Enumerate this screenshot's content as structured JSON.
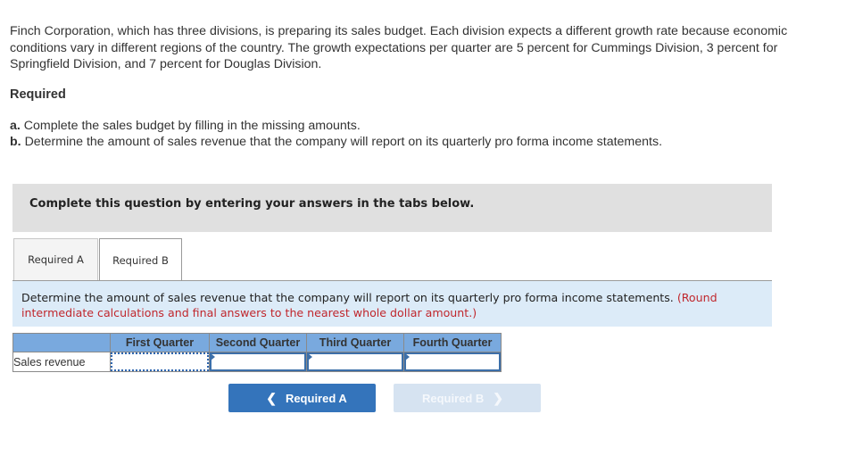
{
  "intro": {
    "paragraph": "Finch Corporation, which has three divisions, is preparing its sales budget. Each division expects a different growth rate because economic conditions vary in different regions of the country. The growth expectations per quarter are 5 percent for Cummings Division, 3 percent for Springfield Division, and 7 percent for Douglas Division."
  },
  "required": {
    "heading": "Required",
    "items": [
      {
        "letter": "a.",
        "text": "Complete the sales budget by filling in the missing amounts."
      },
      {
        "letter": "b.",
        "text": "Determine the amount of sales revenue that the company will report on its quarterly pro forma income statements."
      }
    ]
  },
  "instruction_box": {
    "text": "Complete this question by entering your answers in the tabs below."
  },
  "tabs": [
    {
      "label": "Required A",
      "active": false
    },
    {
      "label": "Required B",
      "active": true
    }
  ],
  "panel": {
    "text": "Determine the amount of sales revenue that the company will report on its quarterly pro forma income statements.",
    "note": "(Round intermediate calculations and final answers to the nearest whole dollar amount.)"
  },
  "table": {
    "columns": [
      "",
      "First Quarter",
      "Second Quarter",
      "Third Quarter",
      "Fourth Quarter"
    ],
    "rows": [
      {
        "label": "Sales revenue",
        "values": [
          "",
          "",
          "",
          ""
        ]
      }
    ]
  },
  "navigation": {
    "prev_label": "Required A",
    "next_label": "Required B",
    "prev_icon": "chevron-left-icon",
    "next_icon": "chevron-right-icon"
  },
  "colors": {
    "accent": "#3474bb",
    "header_blue": "#79a9de",
    "panel_bg": "#dcebf8",
    "note_red": "#c0272d",
    "instruction_bg": "#e0e0e0"
  }
}
